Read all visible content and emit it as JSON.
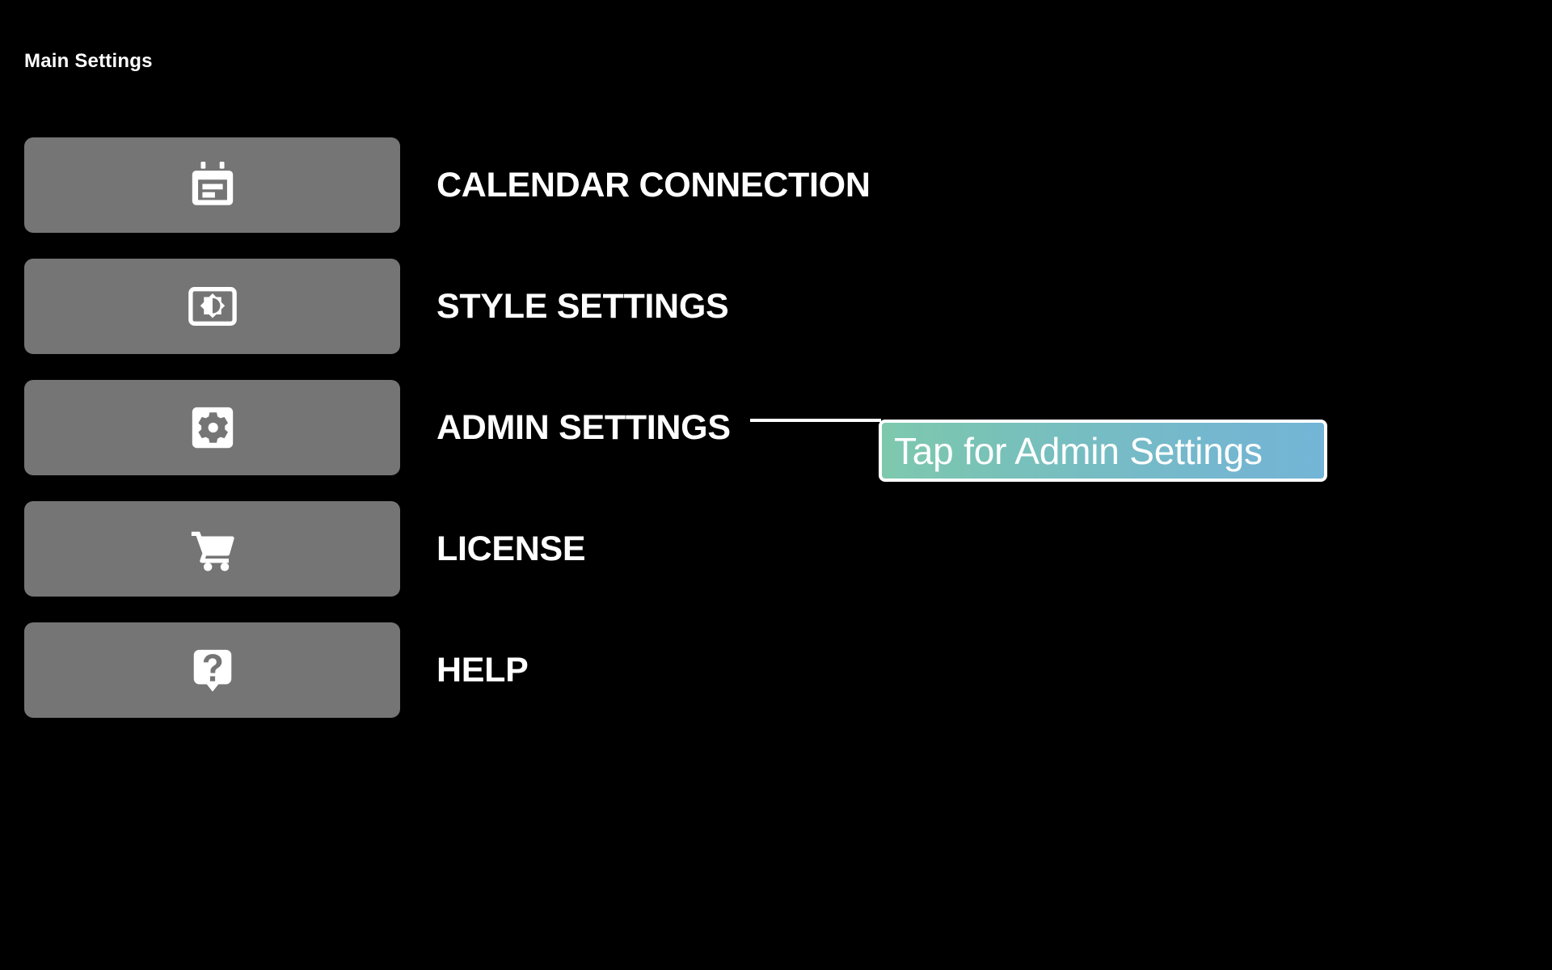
{
  "page": {
    "title": "Main Settings",
    "background_color": "#000000",
    "text_color": "#ffffff"
  },
  "menu": {
    "button_color": "#757575",
    "items": [
      {
        "label": "CALENDAR CONNECTION",
        "icon": "calendar-icon"
      },
      {
        "label": "STYLE SETTINGS",
        "icon": "brightness-icon"
      },
      {
        "label": "ADMIN SETTINGS",
        "icon": "gear-icon"
      },
      {
        "label": "LICENSE",
        "icon": "shopping-cart-icon"
      },
      {
        "label": "HELP",
        "icon": "question-bubble-icon"
      }
    ]
  },
  "callout": {
    "text": "Tap for Admin Settings",
    "target_item": "ADMIN SETTINGS",
    "gradient_start_color": "#7ec9ae",
    "gradient_end_color": "#73b5d6",
    "border_color": "#ffffff",
    "text_color": "#ffffff"
  }
}
